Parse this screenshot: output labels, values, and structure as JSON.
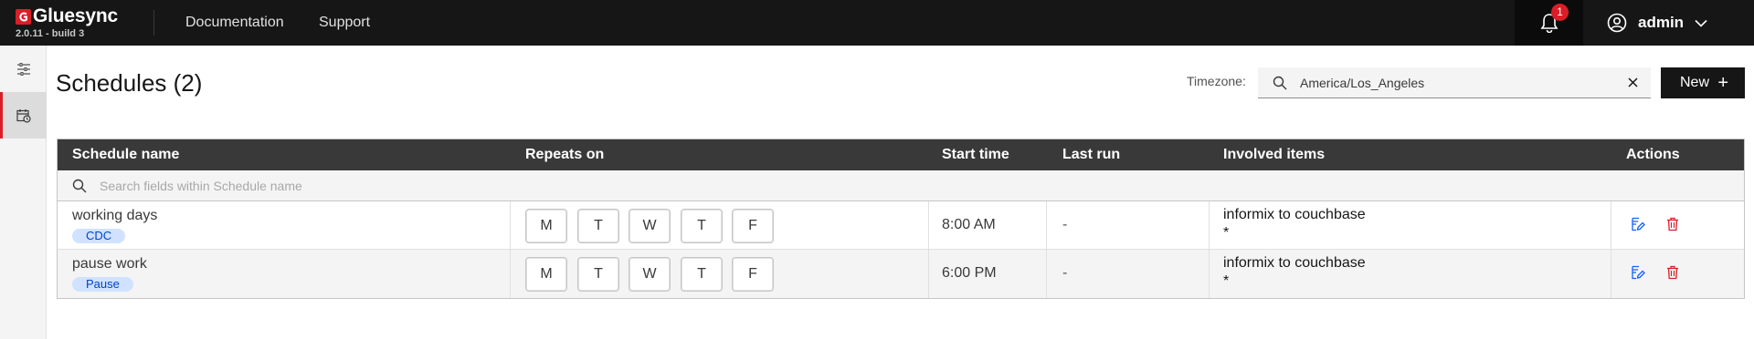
{
  "header": {
    "brand": "Gluesync",
    "version": "2.0.11 - build 3",
    "nav": [
      "Documentation",
      "Support"
    ],
    "notification_count": "1",
    "user": "admin"
  },
  "page": {
    "title": "Schedules (2)",
    "timezone_label": "Timezone:",
    "timezone_value": "America/Los_Angeles",
    "new_button": "New",
    "new_button_icon": "+"
  },
  "table": {
    "columns": [
      "Schedule name",
      "Repeats on",
      "Start time",
      "Last run",
      "Involved items",
      "Actions"
    ],
    "filter_placeholder": "Search fields within Schedule name",
    "rows": [
      {
        "name": "working days",
        "tag": "CDC",
        "days": [
          "M",
          "T",
          "W",
          "T",
          "F"
        ],
        "start_time": "8:00 AM",
        "last_run": "-",
        "involved_name": "informix to couchbase",
        "involved_detail": "*"
      },
      {
        "name": "pause work",
        "tag": "Pause",
        "days": [
          "M",
          "T",
          "W",
          "T",
          "F"
        ],
        "start_time": "6:00 PM",
        "last_run": "-",
        "involved_name": "informix to couchbase",
        "involved_detail": "*"
      }
    ]
  },
  "icons": {
    "brand": "gluesync-logo-icon",
    "notifications": "bell-icon",
    "user": "user-avatar-icon",
    "user_menu": "chevron-down-icon",
    "rail_1": "sliders-icon",
    "rail_2": "calendar-clock-icon",
    "search": "search-icon",
    "clear": "close-icon",
    "edit": "edit-icon",
    "delete": "trash-icon"
  },
  "colors": {
    "header_bg": "#161616",
    "accent_red": "#da1e28",
    "tag_bg": "#d0e2ff",
    "tag_text": "#0043ce",
    "edit_icon": "#0f62fe",
    "delete_icon": "#da1e28"
  }
}
